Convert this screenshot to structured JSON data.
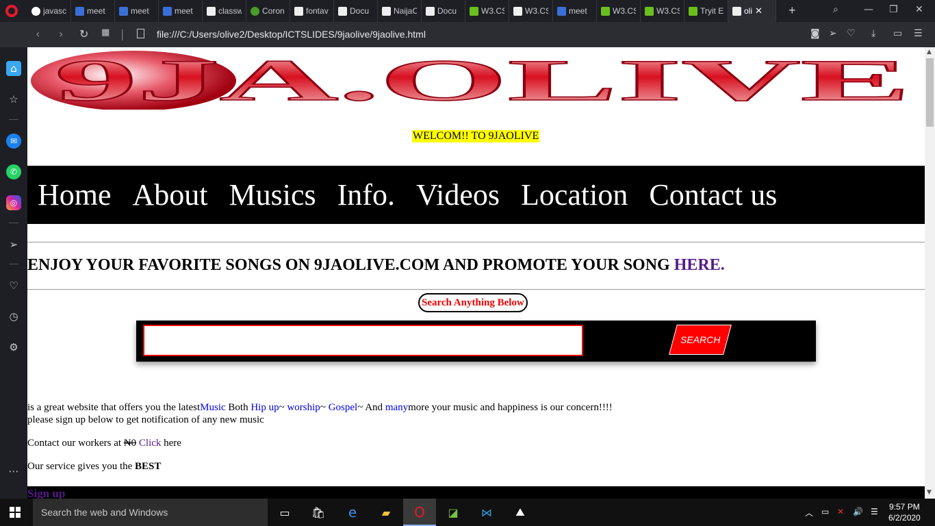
{
  "browser": {
    "tabs": [
      {
        "title": "javasc",
        "icon": "google-icon"
      },
      {
        "title": "meet",
        "icon": "meet-icon"
      },
      {
        "title": "meet",
        "icon": "meet-icon"
      },
      {
        "title": "meet",
        "icon": "meet-icon"
      },
      {
        "title": "classw",
        "icon": "document-icon"
      },
      {
        "title": "Coron",
        "icon": "9ja-icon"
      },
      {
        "title": "fontav",
        "icon": "document-icon"
      },
      {
        "title": "Docu",
        "icon": "document-icon"
      },
      {
        "title": "NaijaC",
        "icon": "document-icon"
      },
      {
        "title": "Docu",
        "icon": "document-icon"
      },
      {
        "title": "W3.CS",
        "icon": "w3-icon"
      },
      {
        "title": "W3.CS",
        "icon": "document-icon"
      },
      {
        "title": "meet",
        "icon": "meet-icon"
      },
      {
        "title": "W3.CS",
        "icon": "w3-icon"
      },
      {
        "title": "W3.CS",
        "icon": "w3-icon"
      },
      {
        "title": "Tryit E",
        "icon": "w3-icon"
      },
      {
        "title": "oli",
        "icon": "document-icon",
        "active": true
      }
    ],
    "url": "file:///C:/Users/olive2/Desktop/ICTSLIDES/9jaolive/9jaolive.html"
  },
  "page": {
    "logo_text": "9JA.OLIVE",
    "welcome": "WELCOM!! TO 9JAOLIVE",
    "nav": [
      "Home",
      "About",
      "Musics",
      "Info.",
      "Videos",
      "Location",
      "Contact us"
    ],
    "headline": "ENJOY YOUR FAVORITE SONGS ON 9JAOLIVE.COM AND PROMOTE YOUR SONG",
    "headline_link": " HERE.",
    "search_label": "Search Anything Below",
    "search_button": "SEARCH",
    "para1": {
      "t1": "is a great website that offers you the latest",
      "l1": "Music",
      "t2": " Both ",
      "l2": "Hip up",
      "t3": "~ ",
      "l3": "worship",
      "t4": "~ ",
      "l4": "Gospel",
      "t5": "~ And ",
      "l5": "many",
      "t6": "more your music and happiness is our concern!!!!"
    },
    "para2": {
      "t1": "please ",
      "l1": "sign",
      "t2": " up below to get notification of any new music"
    },
    "para3": {
      "t1": "Contact our workers at ",
      "naira": "₦0",
      "l1": "Click",
      "t2": " here"
    },
    "para4": {
      "t1": "Our service gives you the ",
      "bold": "BEST"
    },
    "signup": "Sign up"
  },
  "taskbar": {
    "search_placeholder": "Search the web and Windows",
    "time": "9:57 PM",
    "date": "6/2/2020"
  },
  "colors": {
    "welcome_bg": "#ffff00",
    "nav_bg": "#000000",
    "search_button": "#ff0000",
    "accent_red": "#ee0000"
  }
}
